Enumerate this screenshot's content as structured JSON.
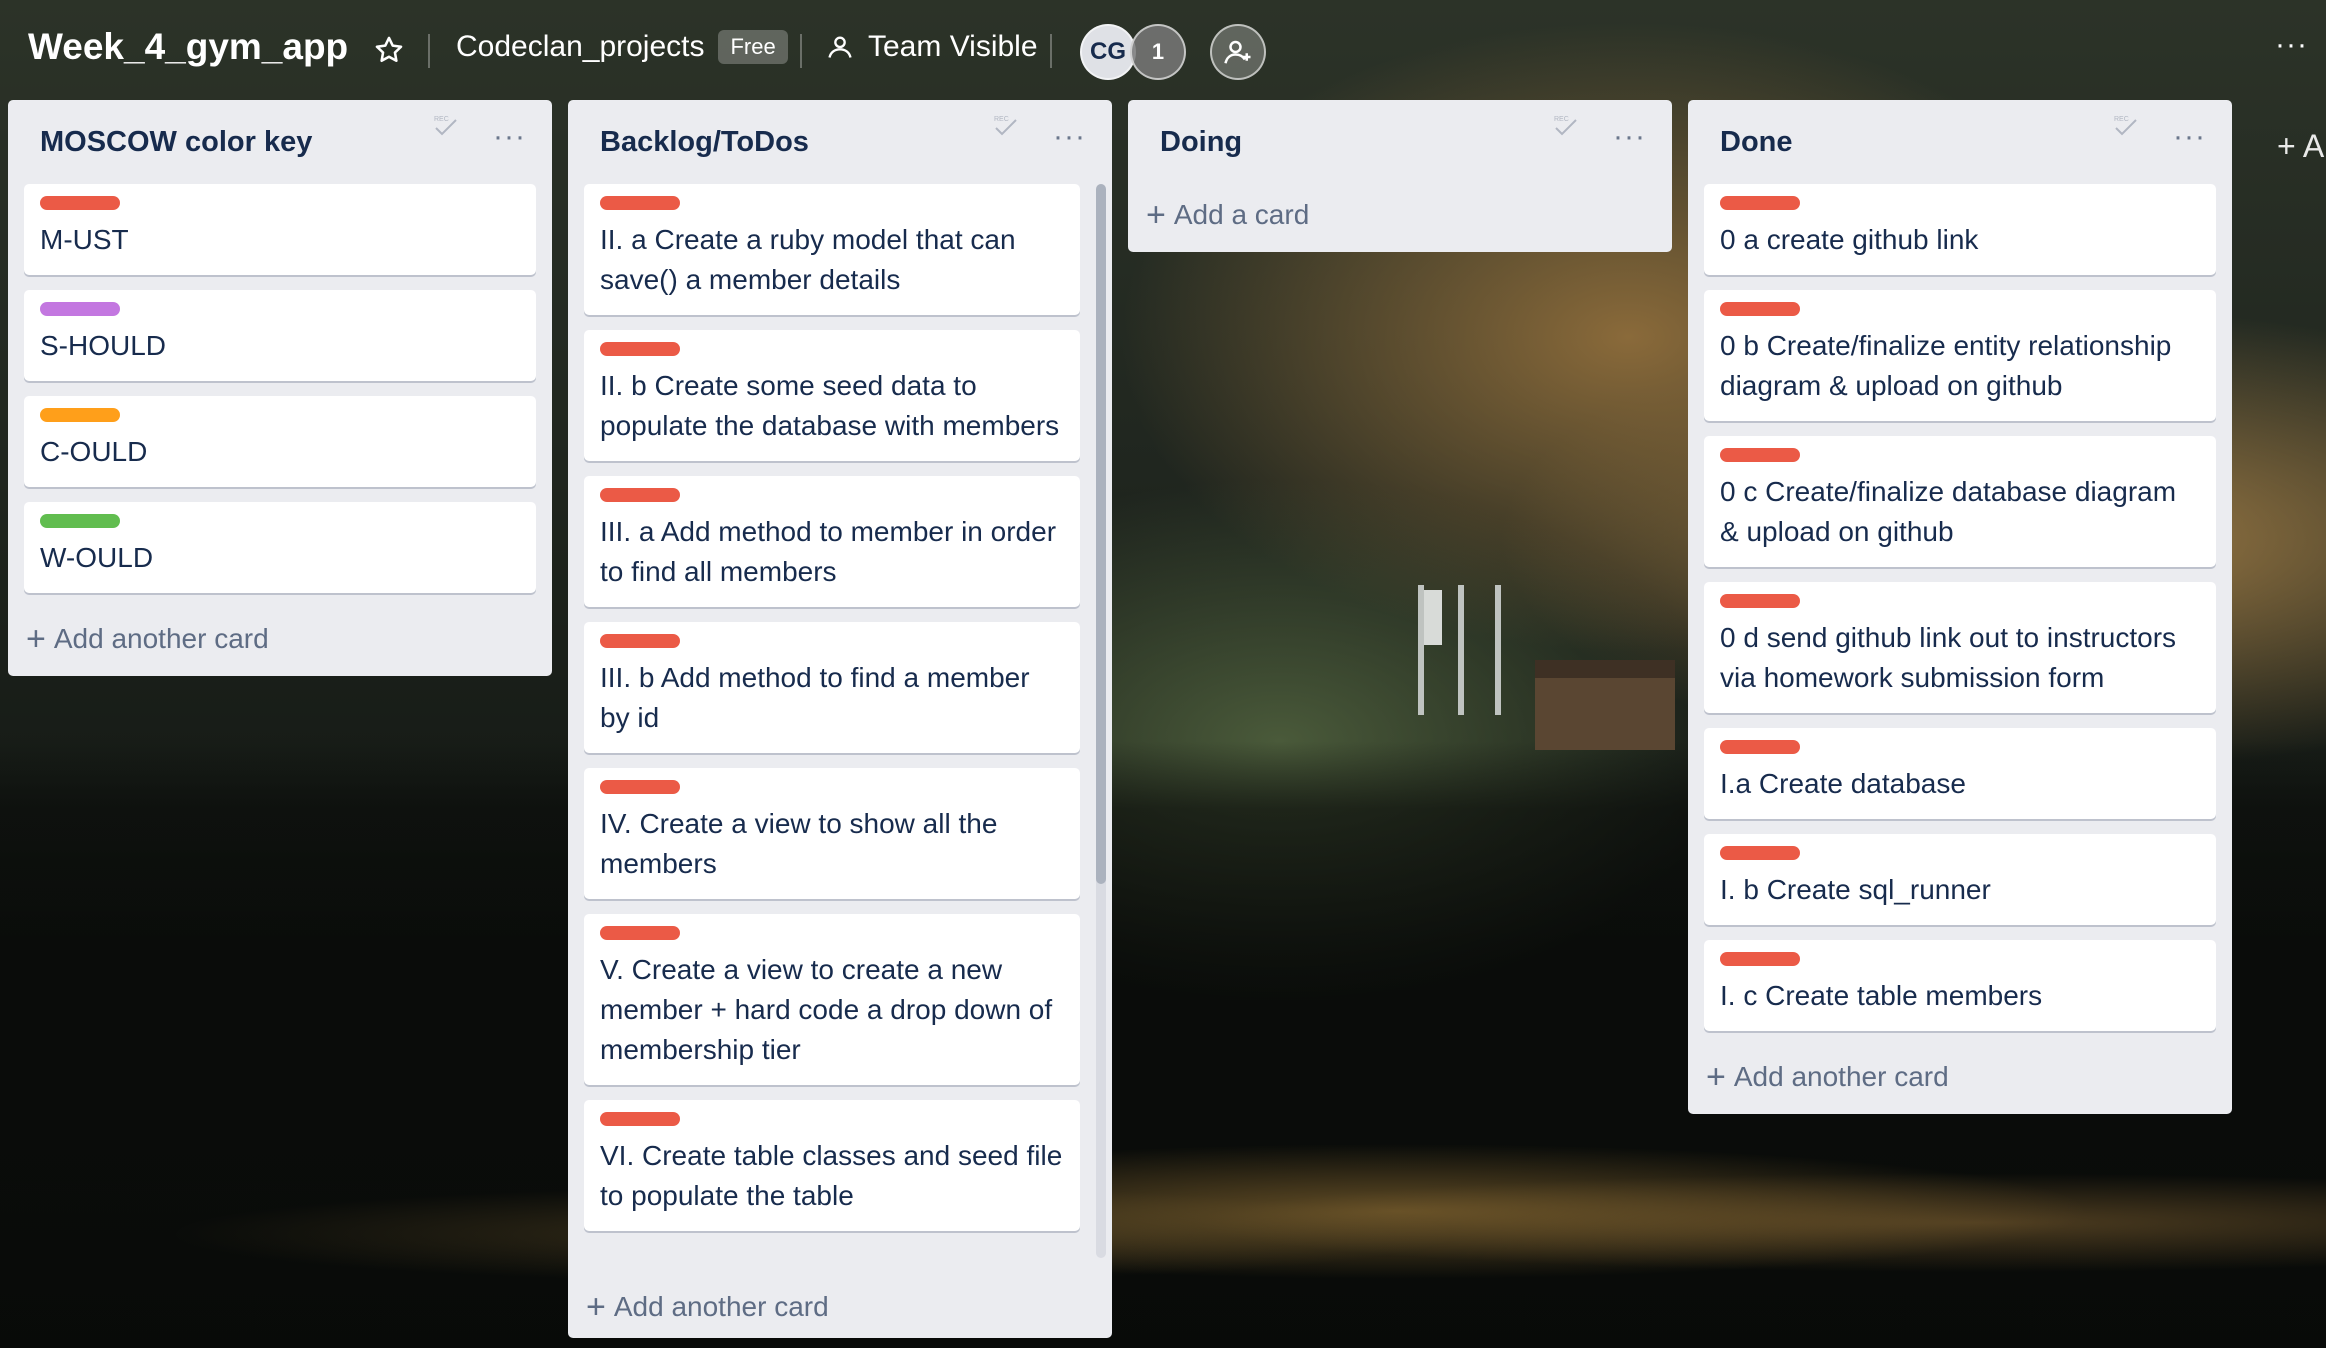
{
  "header": {
    "board_title": "Week_4_gym_app",
    "star_icon": "star-icon",
    "workspace": "Codeclan_projects",
    "plan_badge": "Free",
    "visibility": "Team Visible",
    "visibility_icon": "team-visible-icon",
    "member_initials": "CG",
    "member_count": "1",
    "invite_icon": "add-member-icon",
    "menu": "···"
  },
  "lists": [
    {
      "title": "MOSCOW color key",
      "menu": "···",
      "cards": [
        {
          "label_color": "#eb5a46",
          "title": "M-UST"
        },
        {
          "label_color": "#c377e0",
          "title": "S-HOULD"
        },
        {
          "label_color": "#ff9f1a",
          "title": "C-OULD"
        },
        {
          "label_color": "#61bd4f",
          "title": "W-OULD"
        }
      ],
      "add_label": "Add another card"
    },
    {
      "title": "Backlog/ToDos",
      "menu": "···",
      "cards": [
        {
          "label_color": "#eb5a46",
          "title": "II. a Create a ruby model that can save() a member details"
        },
        {
          "label_color": "#eb5a46",
          "title": "II. b Create some seed data to populate the database with members"
        },
        {
          "label_color": "#eb5a46",
          "title": "III. a Add method to member in order to find all members"
        },
        {
          "label_color": "#eb5a46",
          "title": "III. b Add method to find a member by id"
        },
        {
          "label_color": "#eb5a46",
          "title": "IV. Create a view to show all the members"
        },
        {
          "label_color": "#eb5a46",
          "title": "V. Create a view to create a new member + hard code a drop down of membership tier"
        },
        {
          "label_color": "#eb5a46",
          "title": "VI. Create table classes and seed file to populate the table"
        }
      ],
      "add_label": "Add another card"
    },
    {
      "title": "Doing",
      "menu": "···",
      "cards": [],
      "add_label": "Add a card"
    },
    {
      "title": "Done",
      "menu": "···",
      "cards": [
        {
          "label_color": "#eb5a46",
          "title": "0 a create github link"
        },
        {
          "label_color": "#eb5a46",
          "title": "0 b Create/finalize entity relationship diagram & upload on github"
        },
        {
          "label_color": "#eb5a46",
          "title": "0 c Create/finalize database diagram & upload on github"
        },
        {
          "label_color": "#eb5a46",
          "title": "0 d send github link out to instructors via homework submission form"
        },
        {
          "label_color": "#eb5a46",
          "title": "I.a Create database"
        },
        {
          "label_color": "#eb5a46",
          "title": "I. b Create sql_runner"
        },
        {
          "label_color": "#eb5a46",
          "title": "I. c Create table members"
        }
      ],
      "add_label": "Add another card"
    }
  ],
  "add_list_label": "+ A"
}
